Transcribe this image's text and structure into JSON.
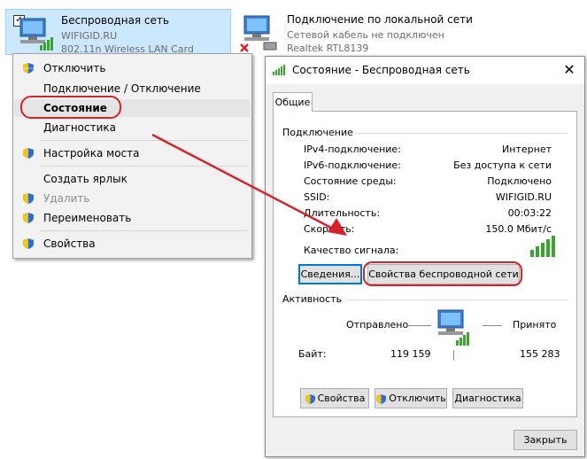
{
  "adapters": [
    {
      "name": "Беспроводная сеть",
      "line1": "WIFIGID.RU",
      "line2": "802.11n Wireless LAN Card"
    },
    {
      "name": "Подключение по локальной сети",
      "line1": "Сетевой кабель не подключен",
      "line2": "Realtek RTL8139"
    }
  ],
  "context_menu": {
    "items": [
      {
        "label": "Отключить",
        "icon": "shield-icon"
      },
      {
        "label": "Подключение / Отключение"
      },
      {
        "label": "Состояние"
      },
      {
        "label": "Диагностика"
      },
      {
        "label": "Настройка моста",
        "icon": "shield-icon"
      },
      {
        "label": "Создать ярлык"
      },
      {
        "label": "Удалить",
        "icon": "shield-icon"
      },
      {
        "label": "Переименовать",
        "icon": "shield-icon"
      },
      {
        "label": "Свойства",
        "icon": "shield-icon"
      }
    ]
  },
  "dialog": {
    "title": "Состояние - Беспроводная сеть",
    "close": "✕",
    "tab": "Общие",
    "connection": {
      "group": "Подключение",
      "rows": [
        {
          "label": "IPv4-подключение:",
          "value": "Интернет"
        },
        {
          "label": "IPv6-подключение:",
          "value": "Без доступа к сети"
        },
        {
          "label": "Состояние среды:",
          "value": "Подключено"
        },
        {
          "label": "SSID:",
          "value": "WIFIGID.RU"
        },
        {
          "label": "Длительность:",
          "value": "00:03:22"
        },
        {
          "label": "Скорость:",
          "value": "150.0 Мбит/с"
        }
      ],
      "signal_label": "Качество сигнала:",
      "signal_bars": 5,
      "details_button": "Сведения...",
      "wireless_props_button": "Свойства беспроводной сети"
    },
    "activity": {
      "group": "Активность",
      "sent_label": "Отправлено",
      "received_label": "Принято",
      "bytes_label": "Байт:",
      "sent_value": "119 159",
      "received_value": "155 283"
    },
    "buttons": {
      "properties": "Свойства",
      "disable": "Отключить",
      "diagnostics": "Диагностика"
    },
    "close_button": "Закрыть"
  },
  "colors": {
    "highlight_ring": "#d6232a",
    "selection": "#cce8ff",
    "signal": "#3aa52e"
  }
}
